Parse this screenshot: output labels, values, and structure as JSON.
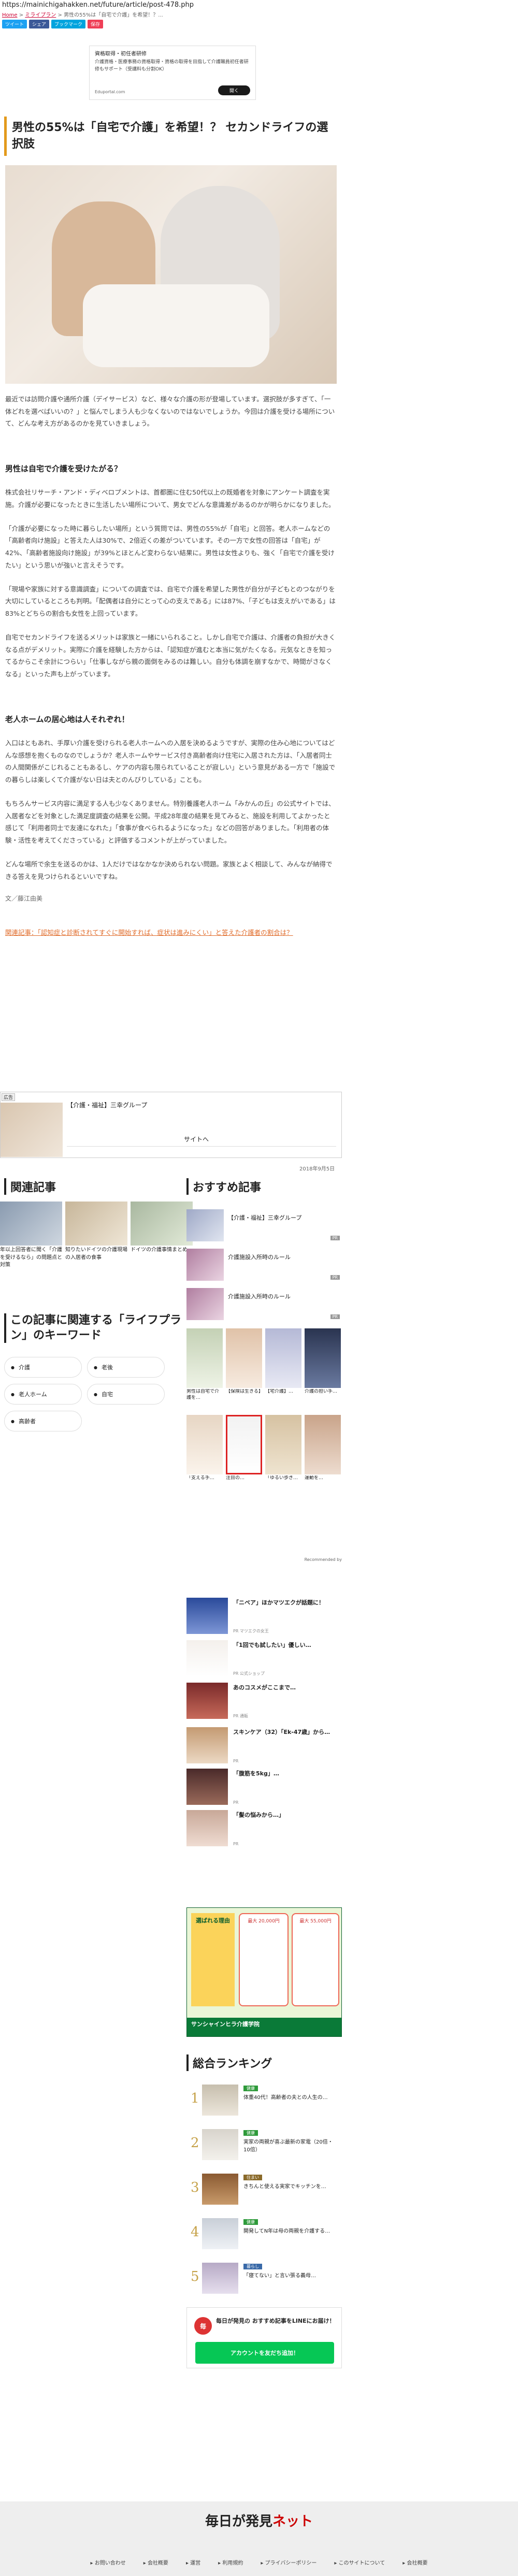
{
  "browser": {
    "url": "https://mainichigahakken.net/future/article/post-478.php"
  },
  "breadcrumb": {
    "home": "Home",
    "sep": ">",
    "cat": "ミライプラン",
    "current": "男性の55%は「自宅で介護」を希望！？..."
  },
  "share": {
    "twitter": "ツイート",
    "facebook": "シェア",
    "hatena": "ブックマーク",
    "pocket": "保存"
  },
  "top_ad": {
    "title": "資格取得・初任者研修",
    "text": "介護資格・医療事務の資格取得・資格の取得を目指して介護職員初任者研修もサポート（受講料も分割OK）",
    "brand": "Eduportal.com",
    "cta": "開く"
  },
  "article": {
    "title": "男性の55%は「自宅で介護」を希望！？ セカンドライフの選択肢",
    "intro": "最近では訪問介護や通所介護（デイサービス）など、様々な介護の形が登場しています。選択肢が多すぎて、「一体どれを選べばいいの？」と悩んでしまう人も少なくないのではないでしょうか。今回は介護を受ける場所について、どんな考え方があるのかを見ていきましょう。",
    "h2_1": "男性は自宅で介護を受けたがる？",
    "p1": "株式会社リサーチ・アンド・ディベロプメントは、首都圏に住む50代以上の既婚者を対象にアンケート調査を実施。介護が必要になったときに生活したい場所について、男女でどんな意識差があるのかが明らかになりました。",
    "p2": "「介護が必要になった時に暮らしたい場所」という質問では、男性の55%が「自宅」と回答。老人ホームなどの「高齢者向け施設」と答えた人は30%で、2倍近くの差がついています。その一方で女性の回答は「自宅」が42%、「高齢者施設向け施設」が39%とほとんど変わらない結果に。男性は女性よりも、強く「自宅で介護を受けたい」という思いが強いと言えそうです。",
    "p3": "「現場や家族に対する意識調査」についての調査では、自宅で介護を希望した男性が自分が子どもとのつながりを大切にしているところも判明。「配偶者は自分にとって心の支えである」には87%、「子どもは支えがいである」は83%とどちらの割合も女性を上回っています。",
    "p4": "自宅でセカンドライフを送るメリットは家族と一緒にいられること。しかし自宅で介護は、介護者の負担が大きくなる点がデメリット。実際に介護を経験した方からは、「認知症が進むと本当に気がたくなる。元気なときを知ってるからこそ余計につらい」「仕事しながら親の面倒をみるのは難しい。自分も体調を崩すなかで、時間がさなくなる」といった声も上がっています。",
    "h2_2": "老人ホームの居心地は人それぞれ！",
    "p5": "入口はともあれ、手厚い介護を受けられる老人ホームへの入居を決めるようですが、実際の住み心地についてはどんな感想を抱くものなのでしょうか？老人ホームやサービス付き高齢者向け住宅に入居された方は、「入居者同士の人間関係がこじれることもあるし、ケアの内容も限られていることが寂しい」という意見がある一方で「施設での暮らしは楽しくて介護がない日は夫とのんびりしている」ことも。",
    "p6": "もちろんサービス内容に満足する人も少なくありません。特別養護老人ホーム「みかんの丘」の公式サイトでは、入居者などを対象とした満足度調査の結果を公開。平成28年度の結果を見てみると、施設を利用してよかったと感じて「利用者同士で友達になれた」「食事が食べられるようになった」などの回答がありました。「利用者の体験・活性を考えてくださっている」と評価するコメントが上がっていました。",
    "p7": "どんな場所で余生を送るのかは、1人だけではなかなか決められない問題。家族とよく相談して、みんなが納得できる答えを見つけられるといいですね。",
    "author": "文／藤江由美",
    "related": "関連記事：「認知症と診断されてすぐに開始すれば、症状は進みにくい」と答えた介護者の割合は？",
    "date": "2018年9月5日"
  },
  "sponsor": {
    "tag": "広告",
    "title": "【介護・福祉】三幸グループ",
    "cta": "サイトへ"
  },
  "related_section": {
    "heading": "関連記事",
    "items": [
      "年以上回答者に聞く「介護を受けるなら」の問題点と対策",
      "知りたいドイツの介護現場の入居者の食事",
      "ドイツの介護事情まとめ"
    ]
  },
  "keywords": {
    "heading": "この記事に関連する「ライフプラン」のキーワード",
    "items": [
      "介護",
      "老後",
      "老人ホーム",
      "自宅",
      "高齢者"
    ]
  },
  "recommend": {
    "heading": "おすすめ記事",
    "items": [
      {
        "title": "【介護・福祉】三幸グループ",
        "pr": "PR"
      },
      {
        "title": "介護施設入所時のルール",
        "pr": "PR"
      },
      {
        "title": "介護施設入所時のルール",
        "pr": "PR"
      }
    ],
    "grid1": [
      "男性は自宅で介護を…",
      "【保険は生きる】",
      "【宅介護】…",
      "介護の担い手…"
    ],
    "grid2": [
      "「支える手…",
      "注目の…",
      "「ゆるい歩き…",
      "運動を…"
    ],
    "powered": "Recommended by"
  },
  "list": [
    {
      "title": "「ニベア」ほかマツエクが話題に！",
      "src": "PR マツエクの女王"
    },
    {
      "title": "「1回でも試したい」優しい…",
      "src": "PR 公式ショップ"
    },
    {
      "title": "あのコスメがここまで…",
      "src": "PR 通販"
    },
    {
      "title": "スキンケア（32）「Ek-47歳」から…",
      "src": "PR"
    },
    {
      "title": "「腹筋を5kg」…",
      "src": "PR"
    },
    {
      "title": "「髪の悩みから…」",
      "src": "PR"
    }
  ],
  "banner": {
    "vertical": "選ばれる理由",
    "box1": "最大 20,000円",
    "box2": "最大 55,000円",
    "foot": "サンシャインヒラ介護学院"
  },
  "ranking": {
    "heading": "総合ランキング",
    "items": [
      {
        "n": "1",
        "cat": "健康",
        "title": "体重40代！高齢者の夫との人生の…"
      },
      {
        "n": "2",
        "cat": "健康",
        "title": "実家の両親が喜ぶ最新の家電（20倍・10倍）"
      },
      {
        "n": "3",
        "cat": "住まい",
        "title": "きちんと使える実家でキッチンを…"
      },
      {
        "n": "4",
        "cat": "健康",
        "title": "開発してN年は母の両親を介護する…"
      },
      {
        "n": "5",
        "cat": "暮らし",
        "title": "「寝てない」と言い張る義母…"
      }
    ]
  },
  "line": {
    "icon": "毎",
    "title": "毎日が発見の おすすめ記事をLINEにお届け！",
    "button": "アカウントを友だち追加！"
  },
  "footer": {
    "logo_a": "毎日が発見",
    "logo_b": "ネット",
    "links": [
      "お問い合わせ",
      "会社概要",
      "運営",
      "利用規約",
      "プライバシーポリシー",
      "このサイトについて",
      "会社概要"
    ]
  },
  "colors": {
    "accent": "#e39a1c",
    "link": "#e06c2b",
    "twitter": "#1da1f2",
    "facebook": "#3b5998",
    "hatena": "#00a4de",
    "pocket": "#ef3f56",
    "line": "#06c755"
  }
}
